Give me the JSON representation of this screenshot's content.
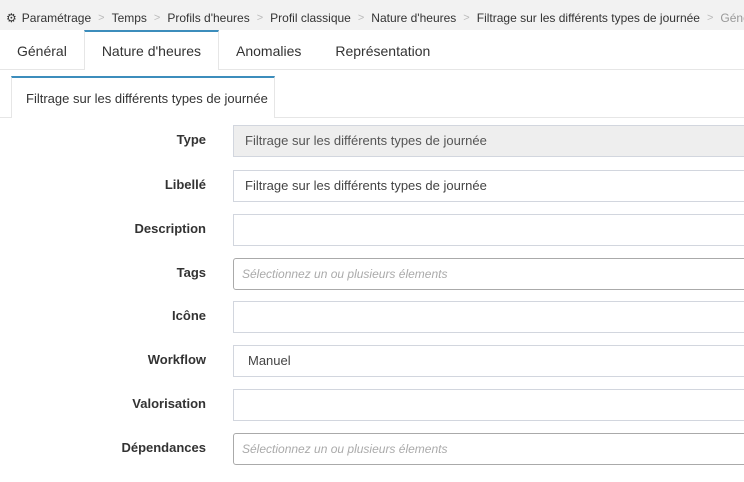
{
  "breadcrumb": {
    "items": [
      "Paramétrage",
      "Temps",
      "Profils d'heures",
      "Profil classique",
      "Nature d'heures",
      "Filtrage sur les différents types de journée",
      "Général"
    ],
    "separator": ">"
  },
  "tabs": {
    "general": "Général",
    "nature": "Nature d'heures",
    "anomalies": "Anomalies",
    "representation": "Représentation"
  },
  "subtab": {
    "label": "Filtrage sur les différents types de journée"
  },
  "form": {
    "type": {
      "label": "Type",
      "value": "Filtrage sur les différents types de journée"
    },
    "libelle": {
      "label": "Libellé",
      "value": "Filtrage sur les différents types de journée"
    },
    "description": {
      "label": "Description",
      "value": ""
    },
    "tags": {
      "label": "Tags",
      "placeholder": "Sélectionnez un ou plusieurs élements"
    },
    "icone": {
      "label": "Icône",
      "value": ""
    },
    "workflow": {
      "label": "Workflow",
      "value": "Manuel"
    },
    "valorisation": {
      "label": "Valorisation",
      "value": ""
    },
    "dependances": {
      "label": "Dépendances",
      "placeholder": "Sélectionnez un ou plusieurs élements"
    }
  },
  "colors": {
    "accent": "#3c8dbc",
    "breadcrumb_bg": "#f2f2f2",
    "readonly_bg": "#eeeeee"
  }
}
